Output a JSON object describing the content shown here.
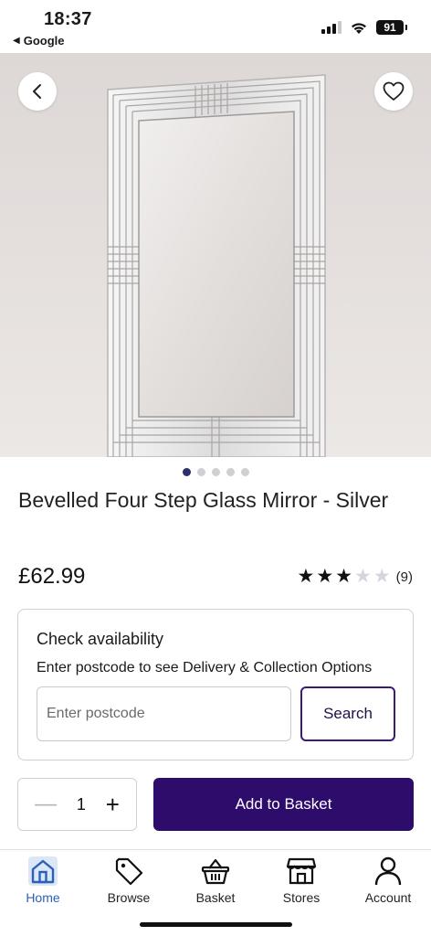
{
  "status_bar": {
    "time": "18:37",
    "back_label": "Google",
    "battery": "91"
  },
  "product": {
    "title": "Bevelled Four Step Glass Mirror - Silver",
    "price": "£62.99",
    "rating": {
      "value": 3,
      "max": 5,
      "count_label": "(9)"
    },
    "image_count": 5,
    "active_image": 1
  },
  "availability": {
    "title": "Check availability",
    "subtitle": "Enter postcode to see Delivery & Collection Options",
    "postcode_placeholder": "Enter postcode",
    "search_label": "Search"
  },
  "basket": {
    "quantity": "1",
    "add_label": "Add to Basket"
  },
  "tabs": [
    {
      "label": "Home",
      "icon": "home-icon",
      "active": true
    },
    {
      "label": "Browse",
      "icon": "tag-icon",
      "active": false
    },
    {
      "label": "Basket",
      "icon": "basket-icon",
      "active": false
    },
    {
      "label": "Stores",
      "icon": "store-icon",
      "active": false
    },
    {
      "label": "Account",
      "icon": "account-icon",
      "active": false
    }
  ],
  "colors": {
    "brand_purple": "#2d0c6b",
    "active_tab": "#2a61b8",
    "carousel_active_dot": "#2b2f6b"
  }
}
